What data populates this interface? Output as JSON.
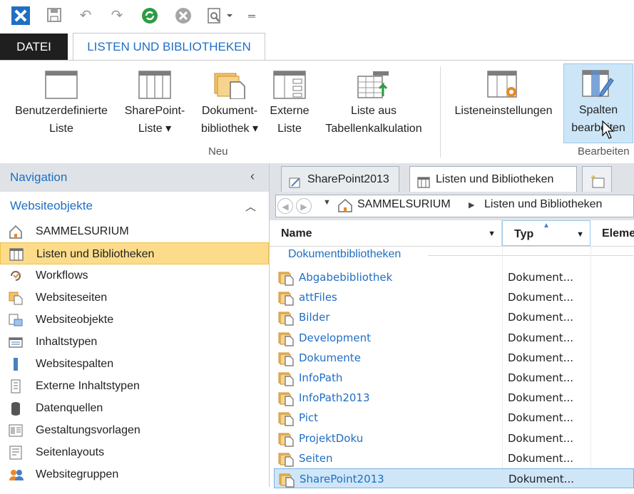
{
  "ribbon_tabs": {
    "file": "DATEI",
    "active": "LISTEN UND BIBLIOTHEKEN"
  },
  "ribbon": {
    "buttons": [
      {
        "line1": "Benutzerdefinierte",
        "line2": "Liste"
      },
      {
        "line1": "SharePoint-",
        "line2": "Liste ▾"
      },
      {
        "line1": "Dokument-",
        "line2": "bibliothek ▾"
      },
      {
        "line1": "Externe",
        "line2": "Liste"
      },
      {
        "line1": "Liste aus",
        "line2": "Tabellenkalkulation"
      },
      {
        "line1": "Listeneinstellungen",
        "line2": ""
      },
      {
        "line1": "Spalten",
        "line2": "bearbeiten"
      }
    ],
    "group_new": "Neu",
    "group_edit": "Bearbeiten"
  },
  "navigation": {
    "title": "Navigation",
    "section": "Websiteobjekte",
    "items": [
      {
        "label": "SAMMELSURIUM",
        "icon": "home-icon"
      },
      {
        "label": "Listen und Bibliotheken",
        "icon": "list-icon",
        "selected": true
      },
      {
        "label": "Workflows",
        "icon": "workflow-icon"
      },
      {
        "label": "Websiteseiten",
        "icon": "site-pages-icon"
      },
      {
        "label": "Websiteobjekte",
        "icon": "site-objects-icon"
      },
      {
        "label": "Inhaltstypen",
        "icon": "content-types-icon"
      },
      {
        "label": "Websitespalten",
        "icon": "site-columns-icon"
      },
      {
        "label": "Externe Inhaltstypen",
        "icon": "external-content-icon"
      },
      {
        "label": "Datenquellen",
        "icon": "data-source-icon"
      },
      {
        "label": "Gestaltungsvorlagen",
        "icon": "templates-icon"
      },
      {
        "label": "Seitenlayouts",
        "icon": "page-layouts-icon"
      },
      {
        "label": "Websitegruppen",
        "icon": "site-groups-icon"
      }
    ]
  },
  "doc_tabs": [
    "SharePoint2013",
    "Listen und Bibliotheken"
  ],
  "breadcrumb": {
    "root": "SAMMELSURIUM",
    "current": "Listen und Bibliotheken",
    "separator": "▶"
  },
  "columns": {
    "name": "Name",
    "type": "Typ",
    "elements": "Eleme"
  },
  "group": "Dokumentbibliotheken",
  "rows": [
    {
      "name": "Abgabebibliothek",
      "type": "Dokument..."
    },
    {
      "name": "attFiles",
      "type": "Dokument..."
    },
    {
      "name": "Bilder",
      "type": "Dokument..."
    },
    {
      "name": "Development",
      "type": "Dokument..."
    },
    {
      "name": "Dokumente",
      "type": "Dokument..."
    },
    {
      "name": "InfoPath",
      "type": "Dokument..."
    },
    {
      "name": "InfoPath2013",
      "type": "Dokument..."
    },
    {
      "name": "Pict",
      "type": "Dokument..."
    },
    {
      "name": "ProjektDoku",
      "type": "Dokument..."
    },
    {
      "name": "Seiten",
      "type": "Dokument..."
    },
    {
      "name": "SharePoint2013",
      "type": "Dokument...",
      "selected": true
    }
  ],
  "colors": {
    "accent": "#1f6fc4",
    "nav_selected": "#fcdc8a",
    "row_selected": "#cfe6f8"
  }
}
